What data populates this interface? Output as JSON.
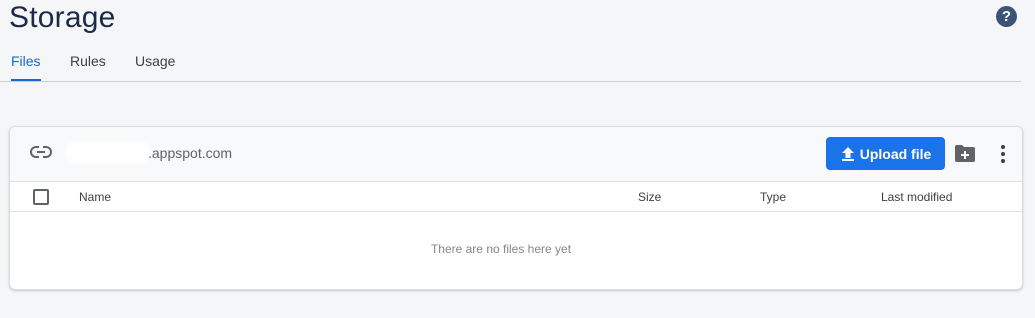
{
  "page": {
    "title": "Storage"
  },
  "tabs": [
    {
      "label": "Files",
      "active": true
    },
    {
      "label": "Rules",
      "active": false
    },
    {
      "label": "Usage",
      "active": false
    }
  ],
  "bucket": {
    "name_suffix": ".appspot.com"
  },
  "toolbar": {
    "upload_label": "Upload file"
  },
  "table": {
    "columns": [
      "Name",
      "Size",
      "Type",
      "Last modified"
    ],
    "empty_message": "There are no files here yet"
  },
  "icons": {
    "help": "help-circle-icon",
    "link": "link-icon",
    "upload": "upload-icon",
    "new_folder": "create-folder-icon",
    "more": "more-vert-icon"
  },
  "colors": {
    "accent": "#1a73e8",
    "title": "#1b2a47",
    "help_icon": "#3c5378"
  }
}
